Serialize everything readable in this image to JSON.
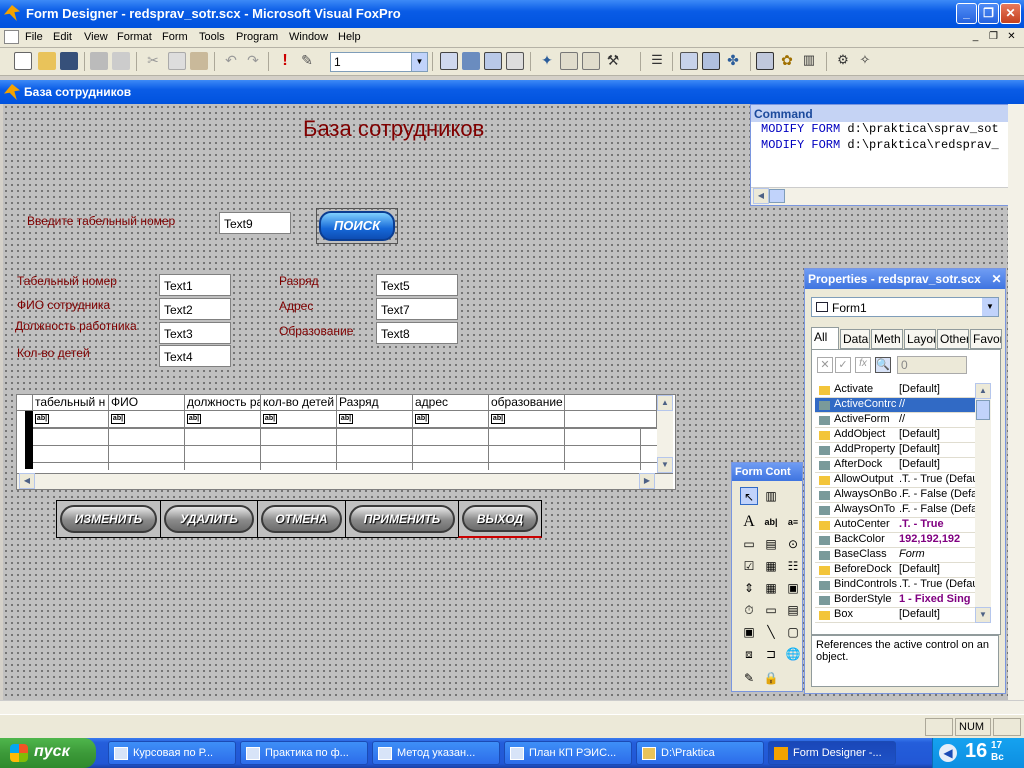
{
  "window": {
    "title": "Form Designer - redsprav_sotr.scx - Microsoft Visual FoxPro"
  },
  "menu": [
    "File",
    "Edit",
    "View",
    "Format",
    "Form",
    "Tools",
    "Program",
    "Window",
    "Help"
  ],
  "toolbar": {
    "combo_value": "1"
  },
  "form": {
    "title": "База сотрудников",
    "heading": "База сотрудников",
    "search_label": "Введите табельный номер",
    "search_box": "Text9",
    "search_button": "ПОИСК",
    "fields": [
      {
        "label": "Табельный номер",
        "value": "Text1"
      },
      {
        "label": "ФИО сотрудника",
        "value": "Text2"
      },
      {
        "label": "Должность работника",
        "value": "Text3"
      },
      {
        "label": "Кол-во детей",
        "value": "Text4"
      },
      {
        "label": "Разряд",
        "value": "Text5"
      },
      {
        "label": "Адрес",
        "value": "Text7"
      },
      {
        "label": "Образование",
        "value": "Text8"
      }
    ],
    "grid_columns": [
      "табельный н",
      "ФИО",
      "должность ра",
      "кол-во детей",
      "Разряд",
      "адрес",
      "образование"
    ],
    "grid_cell_placeholder": "ab|",
    "buttons": [
      "ИЗМЕНИТЬ",
      "УДАЛИТЬ",
      "ОТМЕНА",
      "ПРИМЕНИТЬ",
      "ВЫХОД"
    ]
  },
  "command": {
    "title": "Command",
    "lines": [
      {
        "kw": "MODIFY FORM",
        "arg": "d:\\praktica\\sprav_sot"
      },
      {
        "kw": "MODIFY FORM",
        "arg": "d:\\praktica\\redsprav_"
      }
    ]
  },
  "properties": {
    "title": "Properties - redsprav_sotr.scx",
    "object": "Form1",
    "tabs": [
      "All",
      "Data",
      "Meth",
      "Layou",
      "Other",
      "Favor"
    ],
    "value_box": "0",
    "rows": [
      {
        "name": "Activate",
        "value": "[Default]"
      },
      {
        "name": "ActiveContrc",
        "value": "//"
      },
      {
        "name": "ActiveForm",
        "value": "//"
      },
      {
        "name": "AddObject",
        "value": "[Default]"
      },
      {
        "name": "AddProperty",
        "value": "[Default]"
      },
      {
        "name": "AfterDock",
        "value": "[Default]"
      },
      {
        "name": "AllowOutput",
        "value": ".T. - True (Defau"
      },
      {
        "name": "AlwaysOnBo",
        "value": ".F. - False (Defa"
      },
      {
        "name": "AlwaysOnTo",
        "value": ".F. - False (Defa"
      },
      {
        "name": "AutoCenter",
        "value": ".T. - True"
      },
      {
        "name": "BackColor",
        "value": "192,192,192"
      },
      {
        "name": "BaseClass",
        "value": "Form"
      },
      {
        "name": "BeforeDock",
        "value": "[Default]"
      },
      {
        "name": "BindControls",
        "value": ".T. - True (Defau"
      },
      {
        "name": "BorderStyle",
        "value": "1 - Fixed Sing"
      },
      {
        "name": "Box",
        "value": "[Default]"
      }
    ],
    "description": "References the active control on an object."
  },
  "form_controls": {
    "title": "Form Cont"
  },
  "status": {
    "num": "NUM"
  },
  "taskbar": {
    "start": "пуск",
    "tasks": [
      "Курсовая по Р...",
      "Практика по ф...",
      "Метод указан...",
      "План КП РЭИС...",
      "D:\\Praktica",
      "Form Designer -..."
    ],
    "clock": "16",
    "clock_min": "17",
    "clock_day": "Вс"
  }
}
